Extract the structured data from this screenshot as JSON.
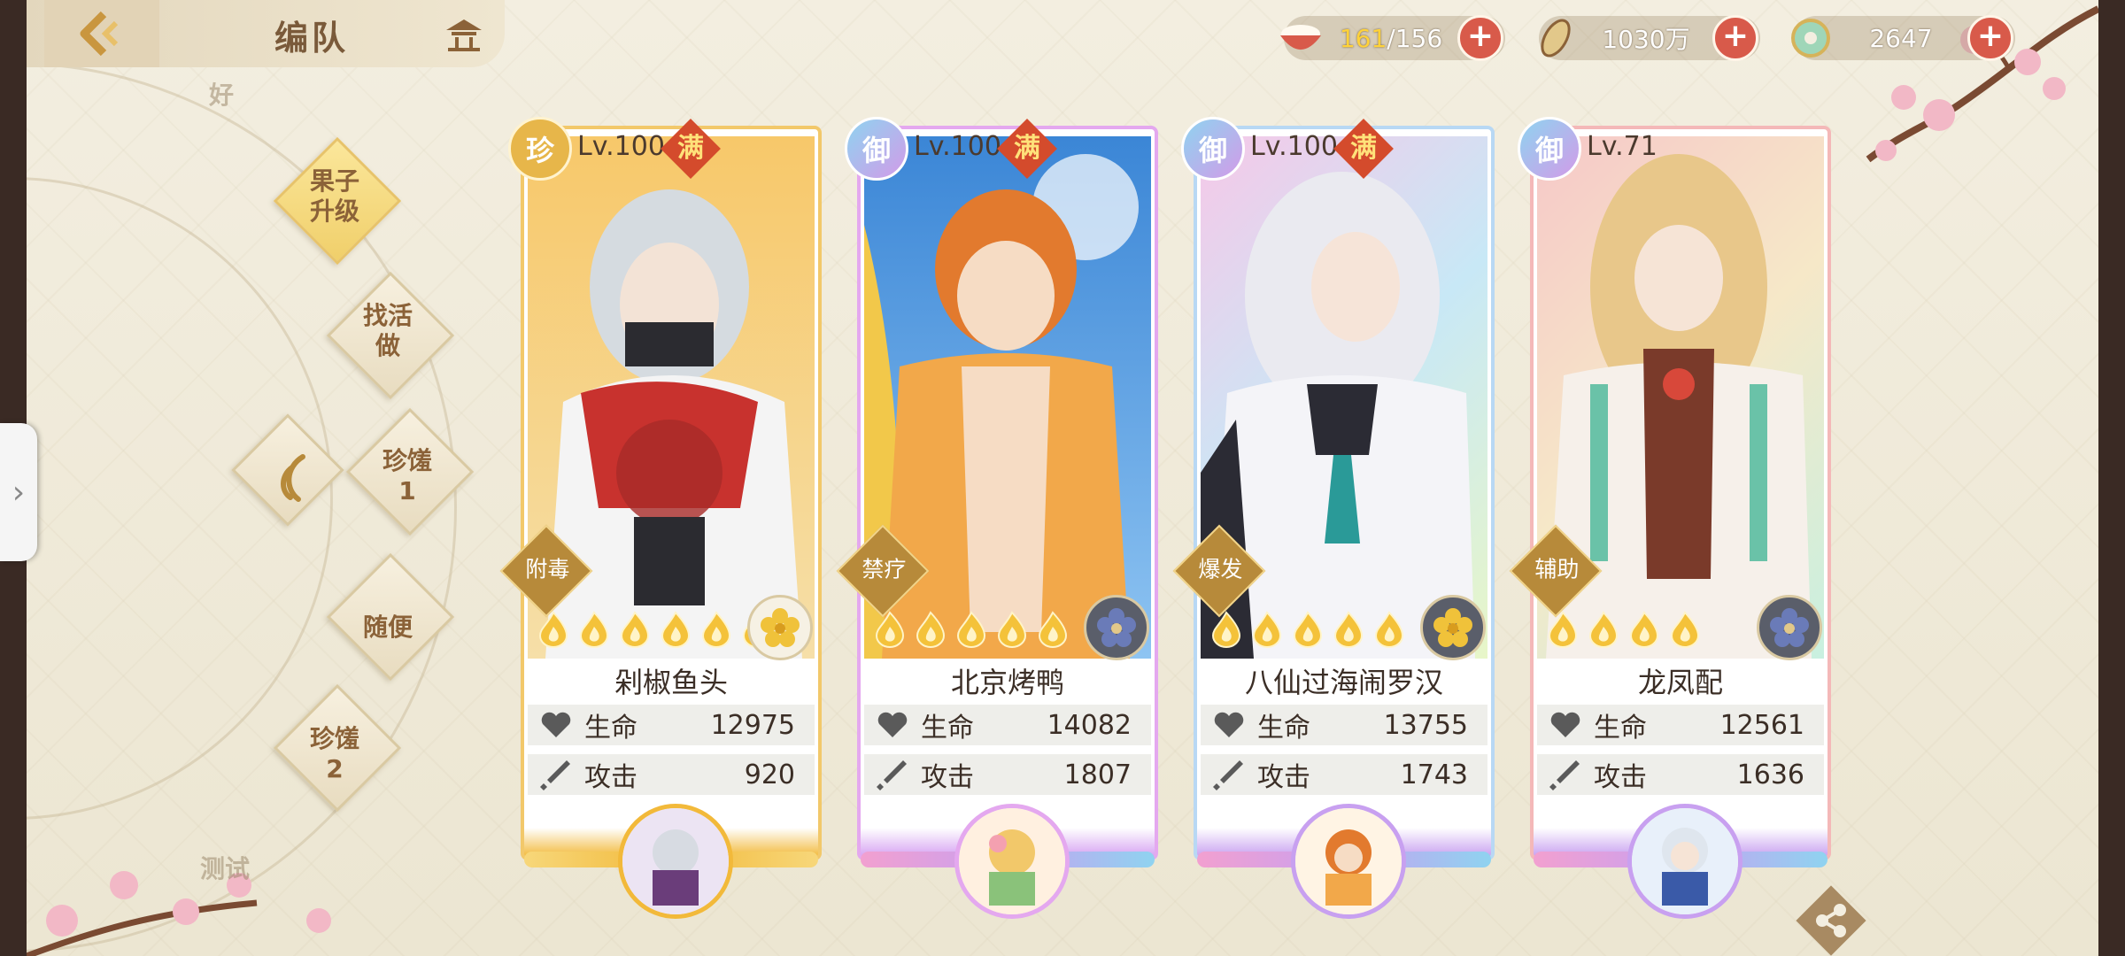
{
  "header": {
    "title": "编队",
    "resources": [
      {
        "name": "stamina",
        "current": "161",
        "max": "/156",
        "icon": "rice-bowl-icon"
      },
      {
        "name": "coins",
        "value": "1030万",
        "icon": "coin-icon"
      },
      {
        "name": "gems",
        "value": "2647",
        "icon": "jade-icon"
      }
    ]
  },
  "menu": {
    "faded_top": "好",
    "items": [
      {
        "label": "果子\n升级"
      },
      {
        "label": "找活\n做"
      },
      {
        "label": "珍馐\n1"
      },
      {
        "label": "随便"
      },
      {
        "label": "珍馐\n2"
      }
    ],
    "faded_bottom": "测试"
  },
  "cards": [
    {
      "rarity": "珍",
      "level": "Lv.100",
      "maxed": "满",
      "tag": "附毒",
      "name": "剁椒鱼头",
      "hp_label": "生命",
      "hp": "12975",
      "atk_label": "攻击",
      "atk": "920",
      "flames": 6
    },
    {
      "rarity": "御",
      "level": "Lv.100",
      "maxed": "满",
      "tag": "禁疗",
      "name": "北京烤鸭",
      "hp_label": "生命",
      "hp": "14082",
      "atk_label": "攻击",
      "atk": "1807",
      "flames": 5
    },
    {
      "rarity": "御",
      "level": "Lv.100",
      "maxed": "满",
      "tag": "爆发",
      "name": "八仙过海闹罗汉",
      "hp_label": "生命",
      "hp": "13755",
      "atk_label": "攻击",
      "atk": "1743",
      "flames": 5
    },
    {
      "rarity": "御",
      "level": "Lv.71",
      "maxed": "",
      "tag": "辅助",
      "name": "龙凤配",
      "hp_label": "生命",
      "hp": "12561",
      "atk_label": "攻击",
      "atk": "1636",
      "flames": 4
    }
  ],
  "colors": {
    "accent": "#d85a4a",
    "menu_text": "#8b6238",
    "gold_card": "#f2b93a",
    "rainbow": "#c8a0f0"
  }
}
